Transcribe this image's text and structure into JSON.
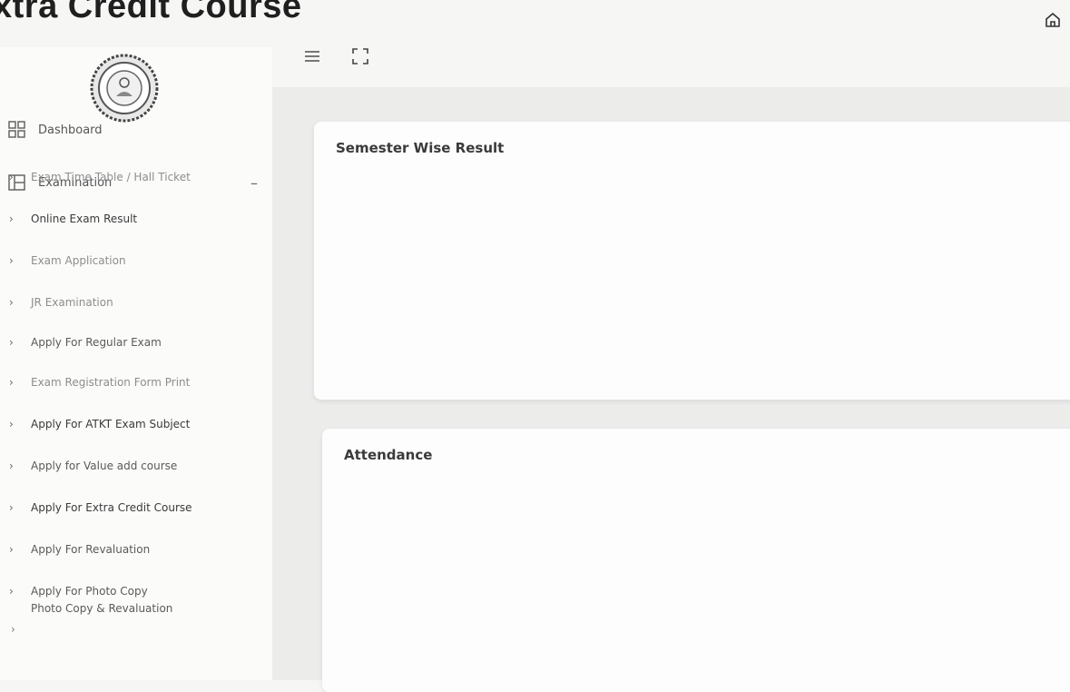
{
  "header": {
    "title": "xtra Credit Course"
  },
  "icons": {
    "home": "home-icon",
    "menu": "hamburger-menu-icon",
    "fullscreen": "fullscreen-icon",
    "logo": "university-seal-logo"
  },
  "sidebar": {
    "dashboard_label": "Dashboard",
    "examination_label": "Examination",
    "examination_toggle": "–",
    "items": [
      {
        "label": "Exam Time Table / Hall Ticket"
      },
      {
        "label": "Online Exam Result"
      },
      {
        "label": "Exam Application"
      },
      {
        "label": "JR Examination"
      },
      {
        "label": "Apply For Regular Exam"
      },
      {
        "label": "Exam Registration Form Print"
      },
      {
        "label": "Apply For ATKT Exam Subject"
      },
      {
        "label": "Apply for Value add course"
      },
      {
        "label": "Apply For Extra Credit Course"
      },
      {
        "label": "Apply For Revaluation"
      },
      {
        "label": "Apply For Photo Copy",
        "label2": "Photo Copy & Revaluation"
      }
    ],
    "chevron": "›"
  },
  "cards": {
    "semester_title": "Semester Wise Result",
    "attendance_title": "Attendance"
  },
  "colors": {
    "background": "#f6f6f5",
    "content_background": "#ececeb",
    "card": "#fdfdfd",
    "text": "#3a3a3a"
  }
}
